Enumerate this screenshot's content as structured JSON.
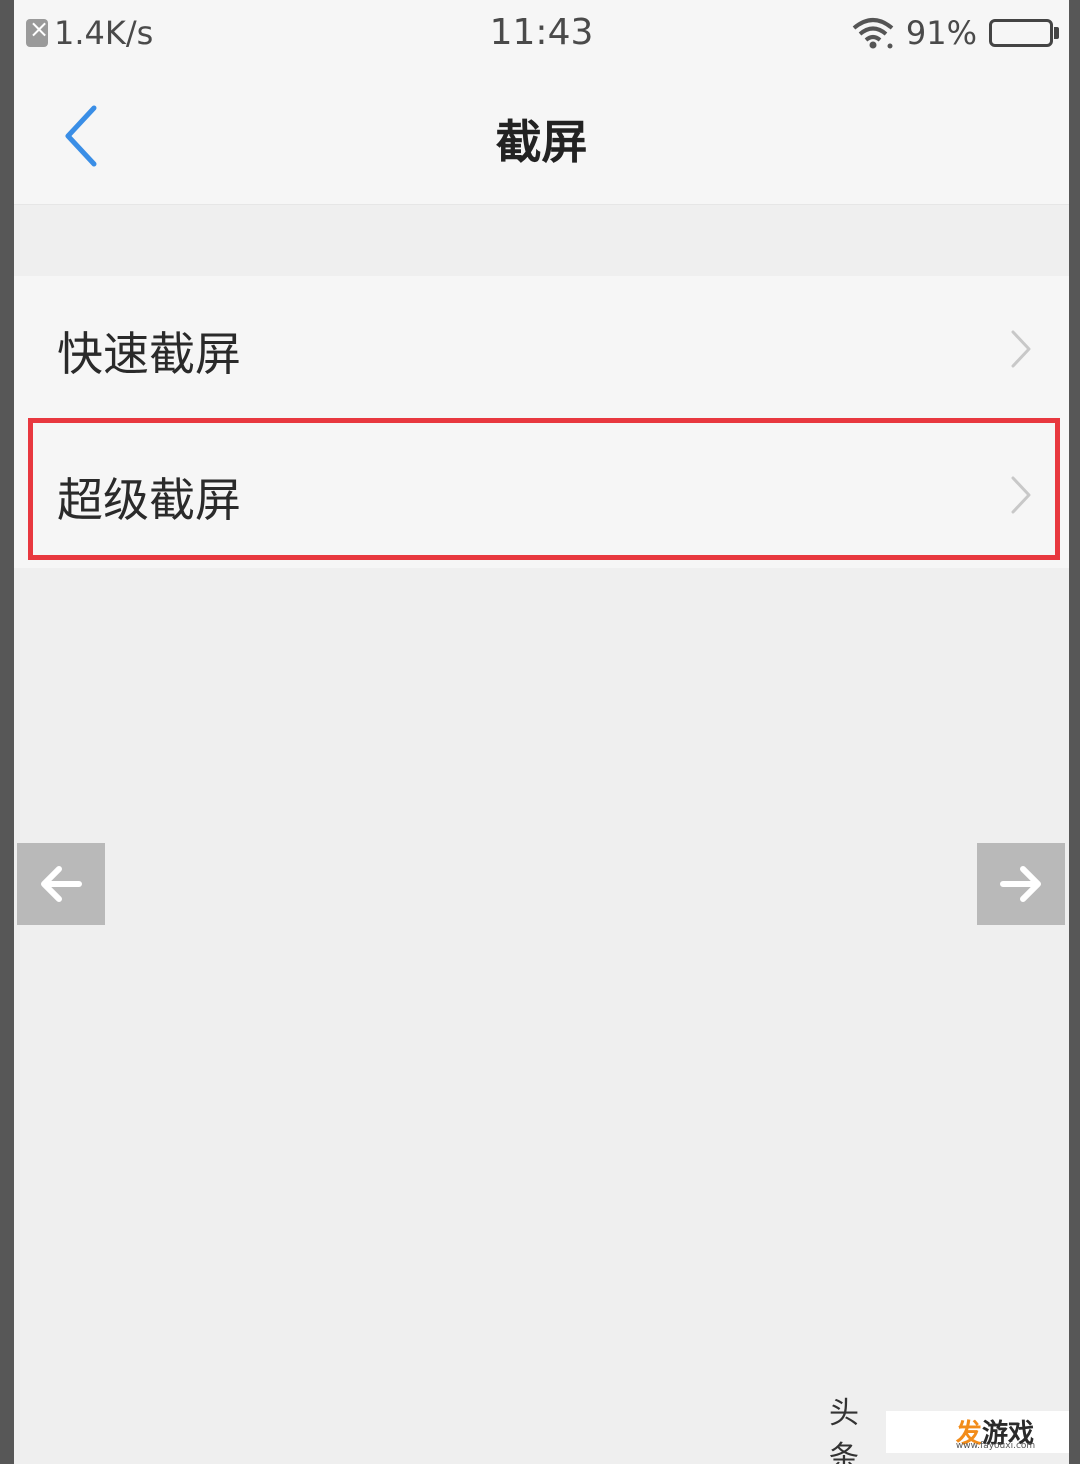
{
  "status_bar": {
    "speed": "1.4K/s",
    "time": "11:43",
    "battery": "91%",
    "battery_level": 0.91
  },
  "nav": {
    "title": "截屏"
  },
  "settings": {
    "items": [
      {
        "label": "快速截屏"
      },
      {
        "label": "超级截屏"
      }
    ]
  },
  "watermark": {
    "prefix": "头条",
    "logo_accent": "发",
    "logo_text": "游戏",
    "url": "www.fayouxi.com"
  },
  "colors": {
    "accent": "#3a8ee6",
    "highlight": "#e8383f"
  }
}
